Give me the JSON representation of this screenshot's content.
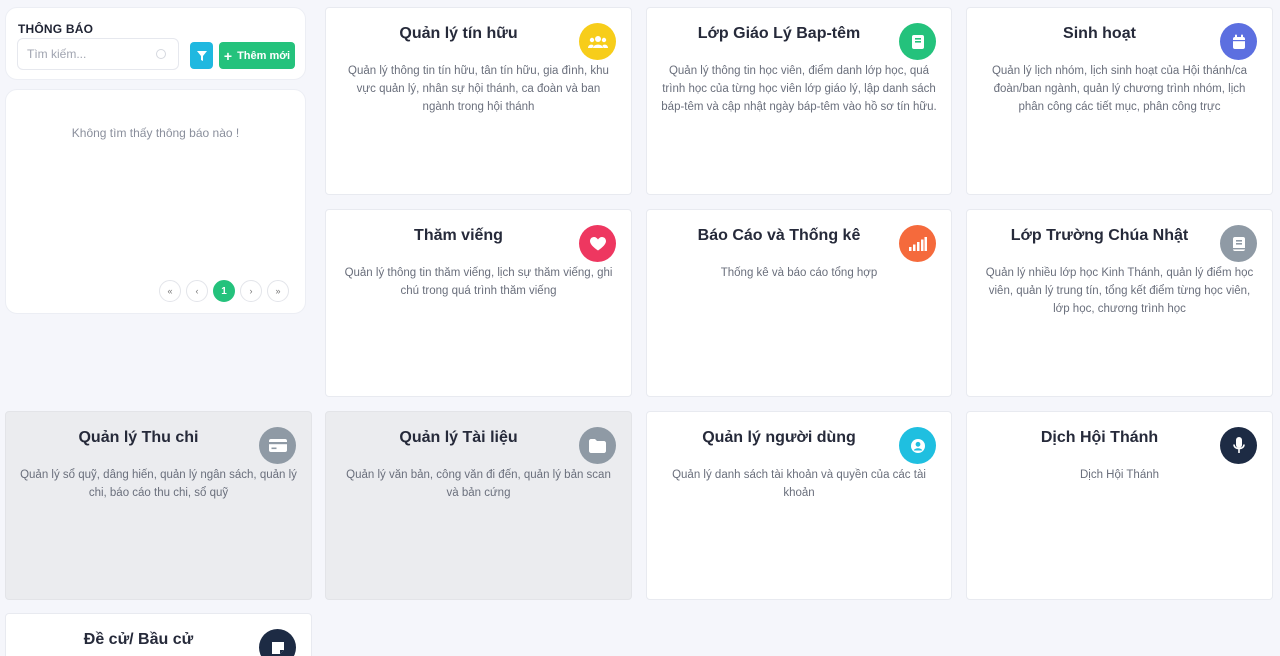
{
  "notifications": {
    "title": "THÔNG BÁO",
    "search_placeholder": "Tìm kiếm...",
    "add_label": "Thêm mới",
    "empty_message": "Không tìm thấy thông báo nào !",
    "pagination": {
      "first": "«",
      "prev": "‹",
      "current": "1",
      "next": "›",
      "last": "»"
    }
  },
  "modules": [
    {
      "title": "Quản lý tín hữu",
      "description": "Quản lý thông tin tín hữu, tân tín hữu, gia đình, khu vực quản lý, nhân sự hội thánh, ca đoàn và ban ngành trong hội thánh",
      "icon": "users-icon",
      "color": "#f7cd1a"
    },
    {
      "title": "Lớp Giáo Lý Bap-têm",
      "description": "Quản lý thông tin học viên, điểm danh lớp học, quá trình học của từng học viên lớp giáo lý, lập danh sách báp-têm và cập nhật ngày báp-têm vào hồ sơ tín hữu.",
      "icon": "book-icon",
      "color": "#24c27c"
    },
    {
      "title": "Sinh hoạt",
      "description": "Quản lý lịch nhóm, lịch sinh hoạt của Hội thánh/ca đoàn/ban ngành, quản lý chương trình nhóm, lịch phân công các tiết mục, phân công trực",
      "icon": "calendar-icon",
      "color": "#5c6fe0"
    },
    {
      "title": "Thăm viếng",
      "description": "Quản lý thông tin thăm viếng, lịch sự thăm viếng, ghi chú trong quá trình thăm viếng",
      "icon": "heart-icon",
      "color": "#ee3760"
    },
    {
      "title": "Báo Cáo và Thống kê",
      "description": "Thống kê và báo cáo tổng hợp",
      "icon": "signal-bars-icon",
      "color": "#f56a3c"
    },
    {
      "title": "Lớp Trường Chúa Nhật",
      "description": "Quản lý nhiều lớp học Kinh Thánh, quản lý điểm học viên, quản lý trung tín, tổng kết điểm từng học viên, lớp học, chương trình học",
      "icon": "notebook-icon",
      "color": "#8f9aa5"
    },
    {
      "title": "Quản lý Thu chi",
      "description": "Quản lý sổ quỹ, dâng hiến, quản lý ngân sách, quản lý chi, báo cáo thu chi, sổ quỹ",
      "icon": "credit-card-icon",
      "color": "#8f9aa5"
    },
    {
      "title": "Quản lý Tài liệu",
      "description": "Quản lý văn bản, công văn đi đến, quản lý bản scan và bản cứng",
      "icon": "folder-icon",
      "color": "#8f9aa5"
    },
    {
      "title": "Quản lý người dùng",
      "description": "Quản lý danh sách tài khoản và quyền của các tài khoản",
      "icon": "user-circle-icon",
      "color": "#1fbfe0"
    },
    {
      "title": "Dịch Hội Thánh",
      "description": "Dịch Hội Thánh",
      "icon": "microphone-icon",
      "color": "#1d2b44"
    },
    {
      "title": "Đề cử/ Bầu cử",
      "description": "",
      "icon": "note-icon",
      "color": "#1d2b44"
    }
  ]
}
